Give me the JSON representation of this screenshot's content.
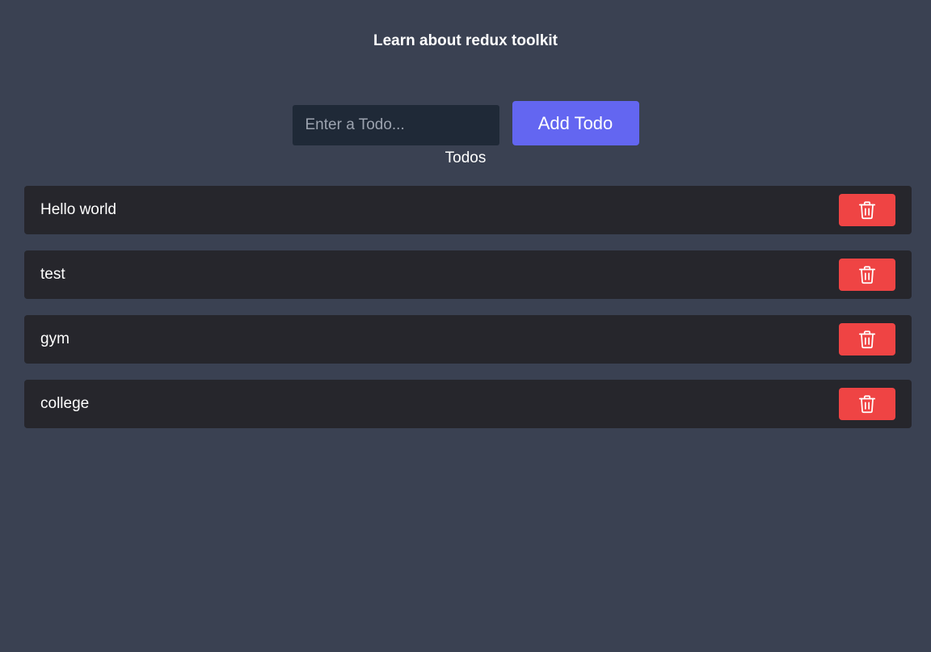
{
  "header": {
    "title": "Learn about redux toolkit"
  },
  "form": {
    "input_value": "",
    "input_placeholder": "Enter a Todo...",
    "add_label": "Add Todo"
  },
  "list": {
    "heading": "Todos",
    "items": [
      {
        "text": "Hello world",
        "delete_icon": "trash-icon"
      },
      {
        "text": "test",
        "delete_icon": "trash-icon"
      },
      {
        "text": "gym",
        "delete_icon": "trash-icon"
      },
      {
        "text": "college",
        "delete_icon": "trash-icon"
      }
    ]
  },
  "colors": {
    "background": "#3a4152",
    "input_background": "#1f2937",
    "accent": "#6366f1",
    "item_background": "#26262c",
    "danger": "#ef4444"
  }
}
